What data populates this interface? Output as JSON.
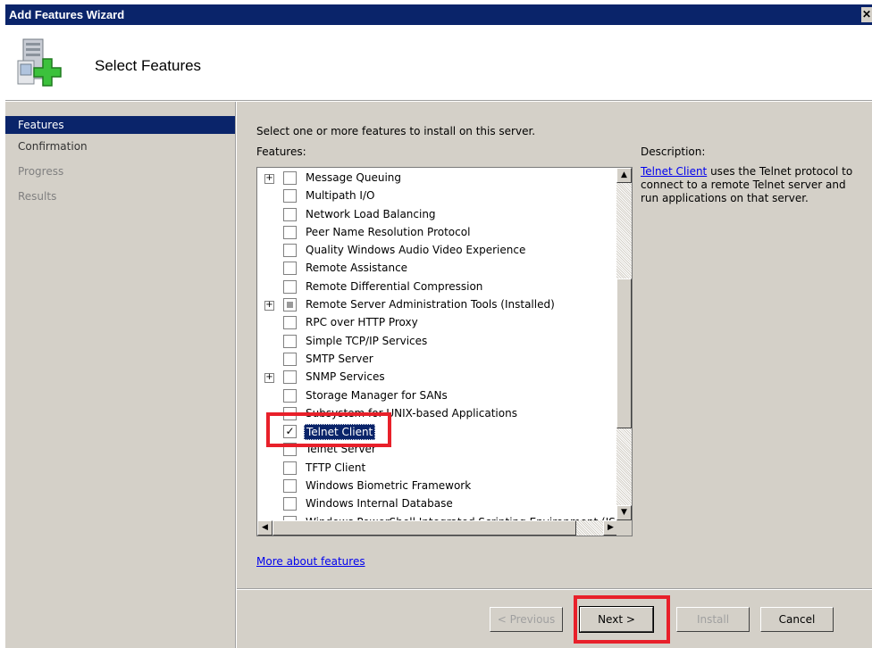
{
  "window": {
    "title": "Add Features Wizard",
    "close_glyph": "✕"
  },
  "header": {
    "title": "Select Features",
    "icon": "server-add-icon"
  },
  "sidebar": {
    "items": [
      {
        "label": "Features",
        "state": "active"
      },
      {
        "label": "Confirmation",
        "state": "normal"
      },
      {
        "label": "Progress",
        "state": "dim"
      },
      {
        "label": "Results",
        "state": "dim"
      }
    ]
  },
  "main": {
    "instruction": "Select one or more features to install on this server.",
    "features_label": "Features:",
    "description_label": "Description:",
    "description_link": "Telnet Client",
    "description_text": " uses the Telnet protocol to connect to a remote Telnet server and run applications on that server.",
    "more_link": "More about features"
  },
  "features": [
    {
      "label": "Message Queuing",
      "expandable": true,
      "state": "unchecked"
    },
    {
      "label": "Multipath I/O",
      "expandable": false,
      "state": "unchecked"
    },
    {
      "label": "Network Load Balancing",
      "expandable": false,
      "state": "unchecked"
    },
    {
      "label": "Peer Name Resolution Protocol",
      "expandable": false,
      "state": "unchecked"
    },
    {
      "label": "Quality Windows Audio Video Experience",
      "expandable": false,
      "state": "unchecked"
    },
    {
      "label": "Remote Assistance",
      "expandable": false,
      "state": "unchecked"
    },
    {
      "label": "Remote Differential Compression",
      "expandable": false,
      "state": "unchecked"
    },
    {
      "label": "Remote Server Administration Tools  (Installed)",
      "expandable": true,
      "state": "partial"
    },
    {
      "label": "RPC over HTTP Proxy",
      "expandable": false,
      "state": "unchecked"
    },
    {
      "label": "Simple TCP/IP Services",
      "expandable": false,
      "state": "unchecked"
    },
    {
      "label": "SMTP Server",
      "expandable": false,
      "state": "unchecked"
    },
    {
      "label": "SNMP Services",
      "expandable": true,
      "state": "unchecked"
    },
    {
      "label": "Storage Manager for SANs",
      "expandable": false,
      "state": "unchecked"
    },
    {
      "label": "Subsystem for UNIX-based Applications",
      "expandable": false,
      "state": "unchecked"
    },
    {
      "label": "Telnet Client",
      "expandable": false,
      "state": "checked",
      "selected": true
    },
    {
      "label": "Telnet Server",
      "expandable": false,
      "state": "unchecked"
    },
    {
      "label": "TFTP Client",
      "expandable": false,
      "state": "unchecked"
    },
    {
      "label": "Windows Biometric Framework",
      "expandable": false,
      "state": "unchecked"
    },
    {
      "label": "Windows Internal Database",
      "expandable": false,
      "state": "unchecked"
    },
    {
      "label": "Windows PowerShell Integrated Scripting Environment (IS",
      "expandable": false,
      "state": "unchecked"
    }
  ],
  "buttons": {
    "previous": "< Previous",
    "next": "Next >",
    "install": "Install",
    "cancel": "Cancel"
  },
  "colors": {
    "titlebar": "#0a246a",
    "highlight": "#e8202a",
    "face": "#d4d0c8"
  }
}
